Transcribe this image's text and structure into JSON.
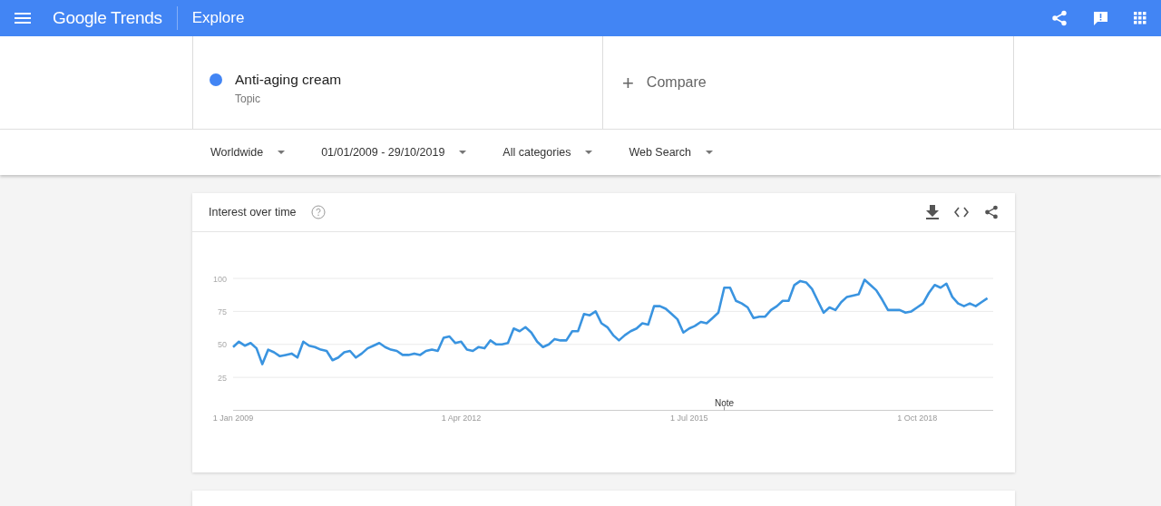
{
  "header": {
    "logo": "Google Trends",
    "page_title": "Explore"
  },
  "search_term": {
    "name": "Anti-aging cream",
    "type": "Topic",
    "color": "#4285f4"
  },
  "compare": {
    "label": "Compare",
    "icon": "+"
  },
  "filters": [
    {
      "label": "Worldwide"
    },
    {
      "label": "01/01/2009 - 29/10/2019"
    },
    {
      "label": "All categories"
    },
    {
      "label": "Web Search"
    }
  ],
  "interest_card": {
    "title": "Interest over time",
    "note_marker": "Note",
    "chart_data": {
      "type": "line",
      "ylim": [
        0,
        100
      ],
      "yticks": [
        25,
        50,
        75,
        100
      ],
      "grid": true,
      "categories": [
        "1 Jan 2009",
        null,
        null,
        null,
        null,
        null,
        null,
        null,
        null,
        null,
        null,
        null,
        null,
        null,
        null,
        null,
        null,
        null,
        null,
        null,
        null,
        null,
        null,
        null,
        null,
        null,
        null,
        null,
        null,
        null,
        null,
        null,
        null,
        null,
        null,
        null,
        null,
        null,
        null,
        "1 Apr 2012",
        null,
        null,
        null,
        null,
        null,
        null,
        null,
        null,
        null,
        null,
        null,
        null,
        null,
        null,
        null,
        null,
        null,
        null,
        null,
        null,
        null,
        null,
        null,
        null,
        null,
        null,
        null,
        null,
        null,
        null,
        null,
        null,
        null,
        null,
        null,
        null,
        null,
        null,
        "1 Jul 2015",
        null,
        null,
        null,
        null,
        null,
        null,
        null,
        null,
        null,
        null,
        null,
        null,
        null,
        null,
        null,
        null,
        null,
        null,
        null,
        null,
        null,
        null,
        null,
        null,
        null,
        null,
        null,
        null,
        null,
        null,
        null,
        null,
        null,
        null,
        null,
        null,
        null,
        null,
        "1 Oct 2018",
        null,
        null,
        null,
        null,
        null,
        null,
        null,
        null,
        null,
        null,
        null,
        null
      ],
      "series": [
        {
          "color": "#3a94e0",
          "values": [
            48,
            52,
            49,
            51,
            47,
            35,
            46,
            44,
            41,
            42,
            43,
            40,
            52,
            49,
            48,
            46,
            45,
            38,
            40,
            44,
            45,
            40,
            43,
            47,
            49,
            51,
            48,
            46,
            45,
            42,
            42,
            43,
            42,
            45,
            46,
            45,
            55,
            56,
            51,
            52,
            46,
            45,
            48,
            47,
            53,
            50,
            50,
            51,
            62,
            60,
            63,
            59,
            52,
            48,
            50,
            54,
            53,
            53,
            60,
            60,
            73,
            72,
            75,
            66,
            63,
            57,
            53,
            57,
            60,
            62,
            66,
            65,
            79,
            79,
            77,
            73,
            69,
            59,
            62,
            64,
            67,
            66,
            70,
            74,
            93,
            93,
            83,
            81,
            78,
            70,
            71,
            71,
            76,
            79,
            83,
            83,
            95,
            98,
            97,
            92,
            83,
            74,
            78,
            76,
            82,
            86,
            87,
            88,
            99,
            95,
            91,
            84,
            76,
            76,
            76,
            74,
            75,
            78,
            81,
            89,
            95,
            93,
            96,
            86,
            81,
            79,
            81,
            79,
            82,
            85
          ]
        }
      ]
    }
  },
  "next_card": {
    "kind": "card"
  }
}
